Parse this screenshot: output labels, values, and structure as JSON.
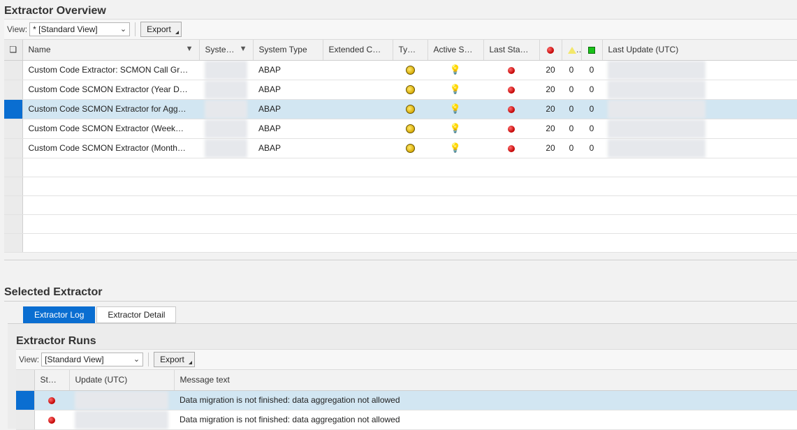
{
  "overview": {
    "title": "Extractor Overview",
    "toolbar": {
      "view_label": "View:",
      "view_value": "* [Standard View]",
      "export_label": "Export"
    },
    "columns": {
      "name": "Name",
      "system": "Syste…",
      "system_type": "System Type",
      "extended": "Extended C…",
      "type": "Ty…",
      "active": "Active S…",
      "last_status": "Last Sta…",
      "last_update": "Last Update (UTC)"
    },
    "rows": [
      {
        "name": "Custom Code Extractor: SCMON Call Gr…",
        "system_type": "ABAP",
        "errors": "20",
        "warnings": "0",
        "ok": "0"
      },
      {
        "name": "Custom Code SCMON Extractor (Year D…",
        "system_type": "ABAP",
        "errors": "20",
        "warnings": "0",
        "ok": "0"
      },
      {
        "name": "Custom Code SCMON Extractor for Agg…",
        "system_type": "ABAP",
        "errors": "20",
        "warnings": "0",
        "ok": "0"
      },
      {
        "name": "Custom Code SCMON Extractor (Week…",
        "system_type": "ABAP",
        "errors": "20",
        "warnings": "0",
        "ok": "0"
      },
      {
        "name": "Custom Code SCMON Extractor (Month…",
        "system_type": "ABAP",
        "errors": "20",
        "warnings": "0",
        "ok": "0"
      }
    ],
    "selected_row_index": 2
  },
  "selected": {
    "title": "Selected Extractor",
    "tabs": [
      {
        "label": "Extractor Log",
        "active": true
      },
      {
        "label": "Extractor Detail",
        "active": false
      }
    ],
    "runs": {
      "title": "Extractor Runs",
      "toolbar": {
        "view_label": "View:",
        "view_value": "[Standard View]",
        "export_label": "Export"
      },
      "columns": {
        "status": "St…",
        "update": "Update (UTC)",
        "message": "Message text"
      },
      "rows": [
        {
          "message": "Data migration is not finished: data aggregation not allowed"
        },
        {
          "message": "Data migration is not finished: data aggregation not allowed"
        }
      ]
    }
  },
  "colors": {
    "accent": "#0a6ed1",
    "selected_row": "#d2e6f2",
    "error": "#c00000",
    "warning": "#f3e76a",
    "ok": "#19c219"
  }
}
